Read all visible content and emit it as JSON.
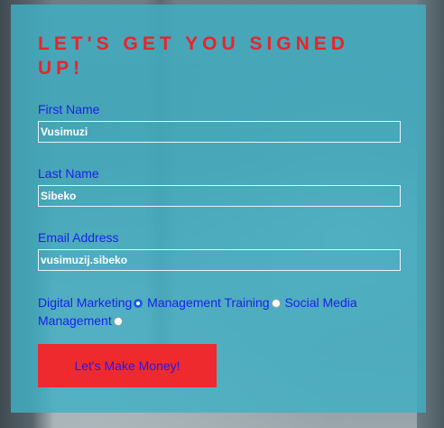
{
  "signup": {
    "title": "LET'S GET YOU SIGNED UP!",
    "first_name": {
      "label": "First Name",
      "value": "Vusimuzi"
    },
    "last_name": {
      "label": "Last Name",
      "value": "Sibeko"
    },
    "email": {
      "label": "Email Address",
      "value": "vusimuzij.sibeko"
    },
    "options": [
      {
        "label": "Digital Marketing",
        "checked": true
      },
      {
        "label": "Management Training",
        "checked": false
      },
      {
        "label": "Social Media Management",
        "checked": false
      }
    ],
    "submit_label": "Let's Make Money!"
  },
  "colors": {
    "panel": "#40b0c4",
    "title": "#e8242b",
    "label": "#1a22e8",
    "button_bg": "#ee2a2e",
    "button_text": "#2a18e0"
  }
}
